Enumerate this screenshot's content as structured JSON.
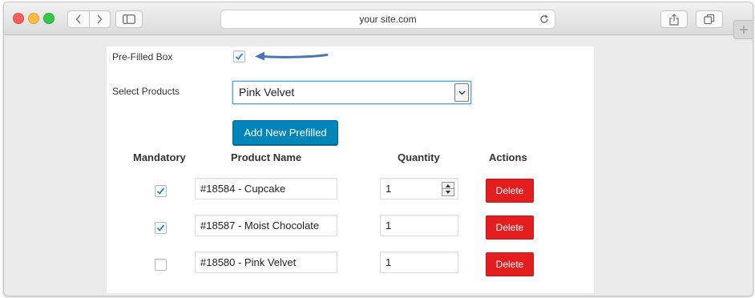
{
  "browser": {
    "url": "your site.com"
  },
  "form": {
    "prefilled_label": "Pre-Filled Box",
    "prefilled_checked": true,
    "select_label": "Select Products",
    "select_value": "Pink Velvet",
    "add_button": "Add New Prefilled"
  },
  "table": {
    "headers": [
      "Mandatory",
      "Product Name",
      "Quantity",
      "Actions"
    ],
    "rows": [
      {
        "mandatory": true,
        "product": "#18584 - Cupcake",
        "quantity": "1",
        "action": "Delete"
      },
      {
        "mandatory": true,
        "product": "#18587 - Moist Chocolate",
        "quantity": "1",
        "action": "Delete"
      },
      {
        "mandatory": false,
        "product": "#18580 - Pink Velvet",
        "quantity": "1",
        "action": "Delete"
      }
    ]
  },
  "colors": {
    "primary_button": "#0085ba",
    "delete_button": "#e41e1e",
    "arrow": "#4a76b6",
    "check": "#1e8cbe"
  },
  "icons": {
    "back": "chevron-left-icon",
    "forward": "chevron-right-icon",
    "sidebar": "sidebar-icon",
    "reload": "reload-icon",
    "share": "share-icon",
    "tabs": "tabs-icon",
    "new_tab": "plus-icon",
    "annotation": "arrow-icon"
  }
}
